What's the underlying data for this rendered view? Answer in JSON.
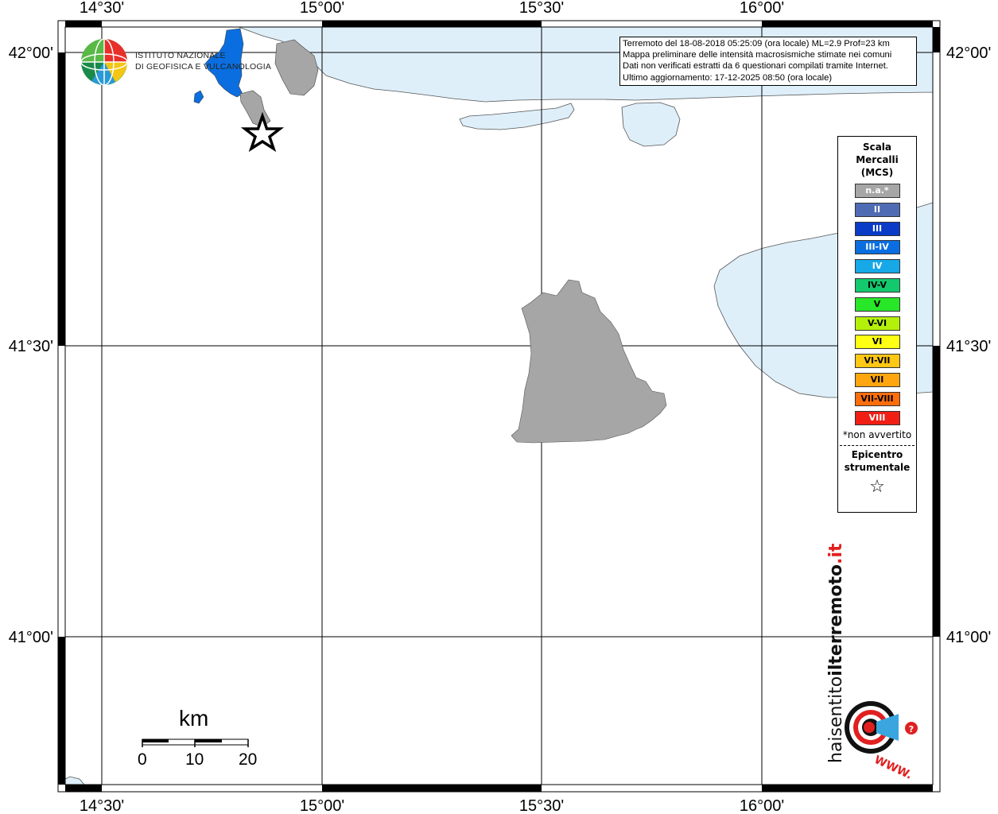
{
  "map": {
    "lon_labels": [
      "14°30'",
      "15°00'",
      "15°30'",
      "16°00'"
    ],
    "lat_labels": [
      "42°00'",
      "41°30'",
      "41°00'"
    ],
    "sea_color": "#deeffa",
    "land_color": "#ffffff"
  },
  "logo": {
    "line1": "ISTITUTO NAZIONALE",
    "line2": "DI GEOFISICA E VULCANOLOGIA"
  },
  "info": {
    "line1": "Terremoto del 18-08-2018 05:25:09 (ora locale) ML=2.9 Prof=23 km",
    "line2": "Mappa preliminare delle intensità macrosismiche stimate nei comuni",
    "line3": "Dati non verificati estratti da 6 questionari compilati tramite Internet.",
    "line4": "Ultimo aggiornamento: 17-12-2025 08:50 (ora locale)"
  },
  "legend": {
    "title1": "Scala",
    "title2": "Mercalli",
    "title3": "(MCS)",
    "items": [
      {
        "label": "n.a.*",
        "color": "#a6a6a6",
        "text_color": "#ffffff"
      },
      {
        "label": "II",
        "color": "#4f6bb4",
        "text_color": "#ffffff"
      },
      {
        "label": "III",
        "color": "#0a3cc8",
        "text_color": "#ffffff"
      },
      {
        "label": "III-IV",
        "color": "#0a6ee0",
        "text_color": "#ffffff"
      },
      {
        "label": "IV",
        "color": "#17a8e8",
        "text_color": "#ffffff"
      },
      {
        "label": "IV-V",
        "color": "#14c86e",
        "text_color": "#000000"
      },
      {
        "label": "V",
        "color": "#28e628",
        "text_color": "#000000"
      },
      {
        "label": "V-VI",
        "color": "#b4f00a",
        "text_color": "#000000"
      },
      {
        "label": "VI",
        "color": "#ffff14",
        "text_color": "#000000"
      },
      {
        "label": "VI-VII",
        "color": "#ffc814",
        "text_color": "#000000"
      },
      {
        "label": "VII",
        "color": "#ffa50f",
        "text_color": "#000000"
      },
      {
        "label": "VII-VIII",
        "color": "#ff6e0a",
        "text_color": "#000000"
      },
      {
        "label": "VIII",
        "color": "#f01e14",
        "text_color": "#ffffff"
      }
    ],
    "note": "*non avvertito",
    "epicenter1": "Epicentro",
    "epicenter2": "strumentale",
    "epicenter_symbol": "☆"
  },
  "scale_bar": {
    "unit": "km",
    "ticks": [
      "0",
      "10",
      "20"
    ]
  },
  "watermark": {
    "text_left": "haisentito",
    "text_mid": "ilterremoto",
    "text_right": ".it",
    "text_bottom": "WWW."
  }
}
